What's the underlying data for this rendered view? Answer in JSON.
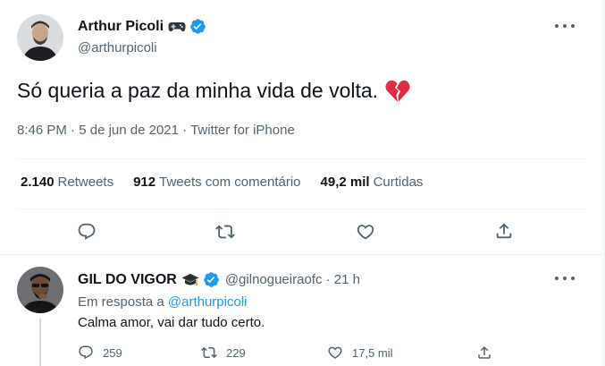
{
  "main_tweet": {
    "author": {
      "name": "Arthur Picoli",
      "handle": "@arthurpicoli",
      "name_emoji": "game-controller",
      "verified": true
    },
    "text": "Só queria a paz da minha vida de volta.",
    "text_emoji": "broken-heart",
    "meta": {
      "time": "8:46 PM",
      "sep1": " · ",
      "date": "5 de jun de 2021",
      "sep2": " · ",
      "source": "Twitter for iPhone"
    },
    "stats": {
      "retweets_count": "2.140",
      "retweets_label": "Retweets",
      "quotes_count": "912",
      "quotes_label": "Tweets com comentário",
      "likes_count": "49,2 mil",
      "likes_label": "Curtidas"
    }
  },
  "reply_tweet": {
    "author": {
      "name": "GIL DO VIGOR",
      "name_emoji": "graduation-cap",
      "verified": true,
      "handle_time": "@gilnogueiraofc · 21 h"
    },
    "replying_prefix": "Em resposta a ",
    "replying_mention": "@arthurpicoli",
    "text": "Calma amor, vai dar tudo certo.",
    "counts": {
      "replies": "259",
      "retweets": "229",
      "likes": "17,5 mil"
    }
  },
  "colors": {
    "text_primary": "#0f1419",
    "text_secondary": "#536471",
    "accent": "#1d9bf0",
    "divider": "#eff3f4",
    "broken_heart": "#dd2e44"
  }
}
